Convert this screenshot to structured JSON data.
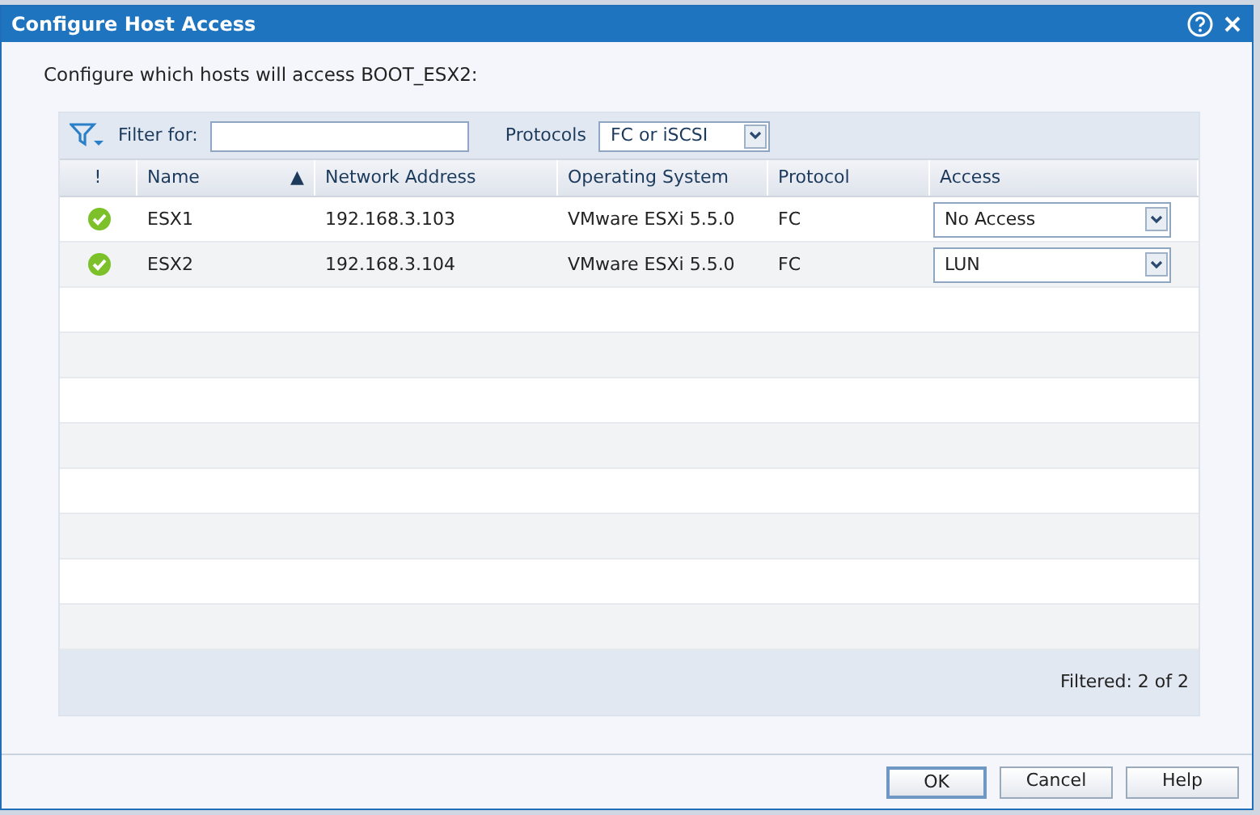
{
  "window": {
    "title": "Configure Host Access"
  },
  "prompt": "Configure which hosts will access BOOT_ESX2:",
  "filter": {
    "label": "Filter for:",
    "protocols_label": "Protocols",
    "protocols_value": "FC or iSCSI"
  },
  "table": {
    "columns": [
      {
        "label": "!"
      },
      {
        "label": "Name",
        "sort": "▲"
      },
      {
        "label": "Network Address"
      },
      {
        "label": "Operating System"
      },
      {
        "label": "Protocol"
      },
      {
        "label": "Access"
      }
    ],
    "rows": [
      {
        "name": "ESX1",
        "address": "192.168.3.103",
        "os": "VMware ESXi 5.5.0",
        "protocol": "FC",
        "access": "No Access"
      },
      {
        "name": "ESX2",
        "address": "192.168.3.104",
        "os": "VMware ESXi 5.5.0",
        "protocol": "FC",
        "access": "LUN"
      }
    ],
    "footer": "Filtered: 2 of 2"
  },
  "buttons": [
    "OK",
    "Cancel",
    "Help"
  ]
}
